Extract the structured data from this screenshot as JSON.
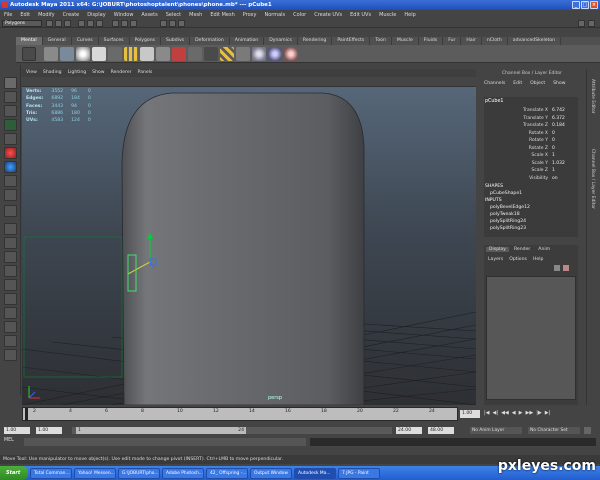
{
  "window": {
    "title": "Autodesk Maya 2011 x64: G:\\JOBURT\\photoshoptalent\\phones\\phone.mb* --- pCube1"
  },
  "menubar": [
    "File",
    "Edit",
    "Modify",
    "Create",
    "Display",
    "Window",
    "Assets",
    "Select",
    "Mesh",
    "Edit Mesh",
    "Proxy",
    "Normals",
    "Color",
    "Create UVs",
    "Edit UVs",
    "Muscle",
    "Help"
  ],
  "statusline": {
    "mode": "Polygons"
  },
  "shelf": {
    "tabs": [
      "Mental",
      "General",
      "Curves",
      "Surfaces",
      "Polygons",
      "Subdivs",
      "Deformation",
      "Animation",
      "Dynamics",
      "Rendering",
      "PaintEffects",
      "Toon",
      "Muscle",
      "Fluids",
      "Fur",
      "Hair",
      "nCloth",
      "advancedSkeleton"
    ],
    "active": "Mental"
  },
  "viewport": {
    "menu": [
      "View",
      "Shading",
      "Lighting",
      "Show",
      "Renderer",
      "Panels"
    ],
    "hud": [
      {
        "label": "Verts:",
        "a": "3552",
        "b": "96",
        "c": "0"
      },
      {
        "label": "Edges:",
        "a": "6892",
        "b": "184",
        "c": "0"
      },
      {
        "label": "Faces:",
        "a": "3443",
        "b": "94",
        "c": "0"
      },
      {
        "label": "Tris:",
        "a": "6886",
        "b": "180",
        "c": "0"
      },
      {
        "label": "UVs:",
        "a": "4583",
        "b": "124",
        "c": "0"
      }
    ],
    "camera": "persp"
  },
  "channelbox": {
    "header": "Channel Box / Layer Editor",
    "menu": [
      "Channels",
      "Edit",
      "Object",
      "Show"
    ],
    "object": "pCube1",
    "channels": [
      {
        "name": "Translate X",
        "value": "6.742"
      },
      {
        "name": "Translate Y",
        "value": "6.372"
      },
      {
        "name": "Translate Z",
        "value": "0.184"
      },
      {
        "name": "Rotate X",
        "value": "0"
      },
      {
        "name": "Rotate Y",
        "value": "0"
      },
      {
        "name": "Rotate Z",
        "value": "0"
      },
      {
        "name": "Scale X",
        "value": "1"
      },
      {
        "name": "Scale Y",
        "value": "1.032"
      },
      {
        "name": "Scale Z",
        "value": "1"
      },
      {
        "name": "Visibility",
        "value": "on"
      }
    ],
    "shapes_label": "SHAPES",
    "shape": "pCubeShape1",
    "inputs_label": "INPUTS",
    "inputs": [
      "polyBevelEdge12",
      "polyTweak18",
      "polySplitRing24",
      "polySplitRing23"
    ]
  },
  "layers": {
    "tabs": [
      "Display",
      "Render",
      "Anim"
    ],
    "menu": [
      "Layers",
      "Options",
      "Help"
    ]
  },
  "side_tabs": [
    "Attribute Editor",
    "Channel Box / Layer Editor"
  ],
  "timeline": {
    "ticks": [
      "2",
      "4",
      "6",
      "8",
      "10",
      "12",
      "14",
      "16",
      "18",
      "20",
      "22",
      "24"
    ],
    "current": "1.00"
  },
  "range": {
    "start": "1.00",
    "start2": "1.00",
    "end": "24.00",
    "end2": "48.00",
    "inner_start": "1",
    "inner_end": "24",
    "anim_layer": "No Anim Layer",
    "char_set": "No Character Set"
  },
  "cmdline": {
    "label": "MEL"
  },
  "helpline": "Move Tool: Use manipulator to move object(s). Use edit mode to change pivot (INSERT). Ctrl+LMB to move perpendicular.",
  "taskbar": {
    "start": "Start",
    "tasks": [
      "Total Comman...",
      "Yahoo! Messen...",
      "G:\\JOBURT\\pho...",
      "Adobe Photosh...",
      "42_ Offspring -...",
      "Output Window",
      "Autodesk Ma...",
      "7.JPG - Paint"
    ],
    "active_index": 6
  },
  "watermark": "pxleyes.com",
  "colors": {
    "title": "#2a5cc8",
    "viewport_top": "#566779",
    "viewport_bottom": "#2d2f33",
    "hud": "#8fd0e0",
    "accent_green": "#00c040"
  }
}
